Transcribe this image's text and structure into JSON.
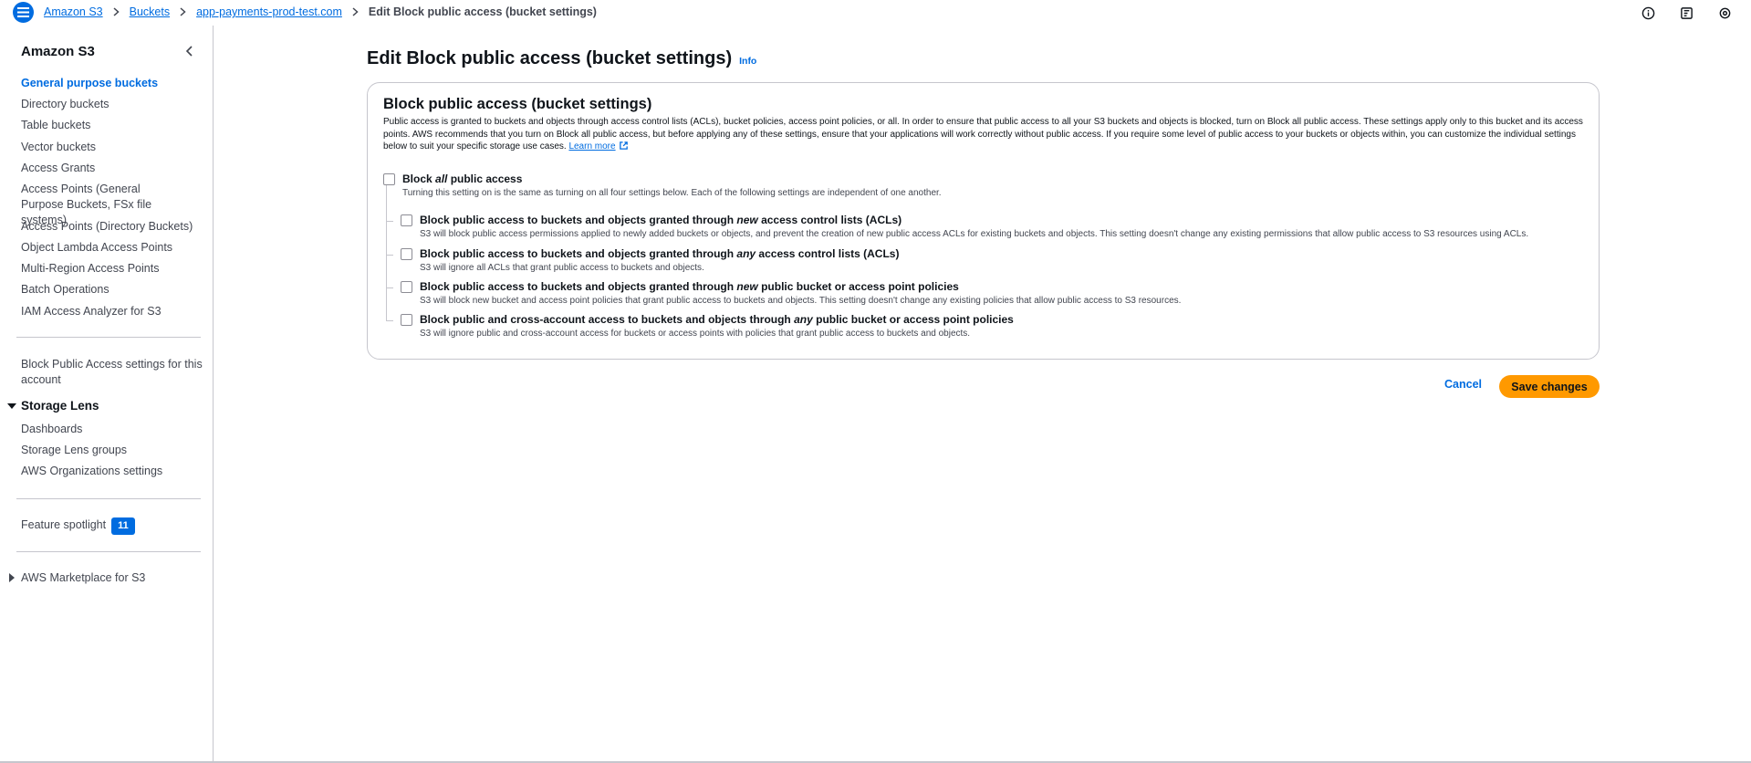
{
  "breadcrumb": {
    "items": [
      "Amazon S3",
      "Buckets",
      "app-payments-prod-test.com"
    ],
    "current": "Edit Block public access (bucket settings)"
  },
  "top_icons": [
    "info-circle-icon",
    "document-export-icon",
    "settings-gear-icon"
  ],
  "sidebar": {
    "title": "Amazon S3",
    "items": [
      "General purpose buckets",
      "Directory buckets",
      "Table buckets",
      "Vector buckets",
      "Access Grants",
      "Access Points (General Purpose Buckets, FSx file systems)",
      "Access Points (Directory Buckets)",
      "Object Lambda Access Points",
      "Multi-Region Access Points",
      "Batch Operations",
      "IAM Access Analyzer for S3"
    ],
    "account_setting": "Block Public Access settings for this account",
    "storage_lens": {
      "title": "Storage Lens",
      "items": [
        "Dashboards",
        "Storage Lens groups",
        "AWS Organizations settings"
      ]
    },
    "feature_spotlight": {
      "label": "Feature spotlight",
      "count": "11"
    },
    "marketplace": "AWS Marketplace for S3"
  },
  "main": {
    "title": "Edit Block public access (bucket settings)",
    "info": "Info",
    "panel": {
      "title": "Block public access (bucket settings)",
      "description": "Public access is granted to buckets and objects through access control lists (ACLs), bucket policies, access point policies, or all. In order to ensure that public access to all your S3 buckets and objects is blocked, turn on Block all public access. These settings apply only to this bucket and its access points. AWS recommends that you turn on Block all public access, but before applying any of these settings, ensure that your applications will work correctly without public access. If you require some level of public access to your buckets or objects within, you can customize the individual settings below to suit your specific storage use cases.",
      "learn_more": "Learn more",
      "block_all": {
        "pre": "Block ",
        "em": "all",
        "post": " public access",
        "desc": "Turning this setting on is the same as turning on all four settings below. Each of the following settings are independent of one another.",
        "checked": false
      },
      "options": [
        {
          "pre": "Block public access to buckets and objects granted through ",
          "em": "new",
          "post": " access control lists (ACLs)",
          "desc": "S3 will block public access permissions applied to newly added buckets or objects, and prevent the creation of new public access ACLs for existing buckets and objects. This setting doesn't change any existing permissions that allow public access to S3 resources using ACLs.",
          "checked": false
        },
        {
          "pre": "Block public access to buckets and objects granted through ",
          "em": "any",
          "post": " access control lists (ACLs)",
          "desc": "S3 will ignore all ACLs that grant public access to buckets and objects.",
          "checked": false
        },
        {
          "pre": "Block public access to buckets and objects granted through ",
          "em": "new",
          "post": " public bucket or access point policies",
          "desc": "S3 will block new bucket and access point policies that grant public access to buckets and objects. This setting doesn't change any existing policies that allow public access to S3 resources.",
          "checked": false
        },
        {
          "pre": "Block public and cross-account access to buckets and objects through ",
          "em": "any",
          "post": " public bucket or access point policies",
          "desc": "S3 will ignore public and cross-account access for buckets or access points with policies that grant public access to buckets and objects.",
          "checked": false
        }
      ]
    },
    "cancel": "Cancel",
    "save": "Save changes"
  },
  "colors": {
    "link": "#006ce0",
    "primary_button": "#ff9900",
    "border": "#c6c6cd"
  }
}
